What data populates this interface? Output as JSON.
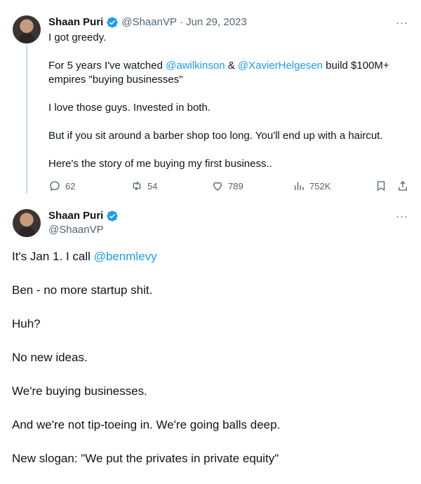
{
  "tweet1": {
    "name": "Shaan Puri",
    "handle": "@ShaanVP",
    "separator": "·",
    "date": "Jun 29, 2023",
    "more": "···",
    "p1": "I got greedy.",
    "p2_pre": "For 5 years I've watched ",
    "mention1": "@awilkinson",
    "p2_mid": " & ",
    "mention2": "@XavierHelgesen",
    "p2_post": " build $100M+ empires \"buying businesses\"",
    "p3": "I love those guys. Invested in both.",
    "p4": "But if you sit around a barber shop too long. You'll end up with a haircut.",
    "p5": "Here's the story of me buying my first business..",
    "stats": {
      "replies": "62",
      "retweets": "54",
      "likes": "789",
      "views": "752K"
    },
    "icons": [
      "reply-icon",
      "retweet-icon",
      "like-icon",
      "views-icon",
      "bookmark-icon",
      "share-icon"
    ]
  },
  "tweet2": {
    "name": "Shaan Puri",
    "handle": "@ShaanVP",
    "more": "···",
    "l1_pre": "It's Jan 1. I call ",
    "mention": "@benmlevy",
    "l2": "Ben - no more startup shit.",
    "l3": "Huh?",
    "l4": "No new ideas.",
    "l5": "We're buying businesses.",
    "l6": "And we're not tip-toeing in. We're going balls deep.",
    "l7": "New slogan: \"We put the privates in private equity\""
  },
  "colors": {
    "link": "#1d9bf0",
    "verified": "#1d9bf0",
    "muted": "#536471",
    "thread_line": "#cfd9de"
  }
}
